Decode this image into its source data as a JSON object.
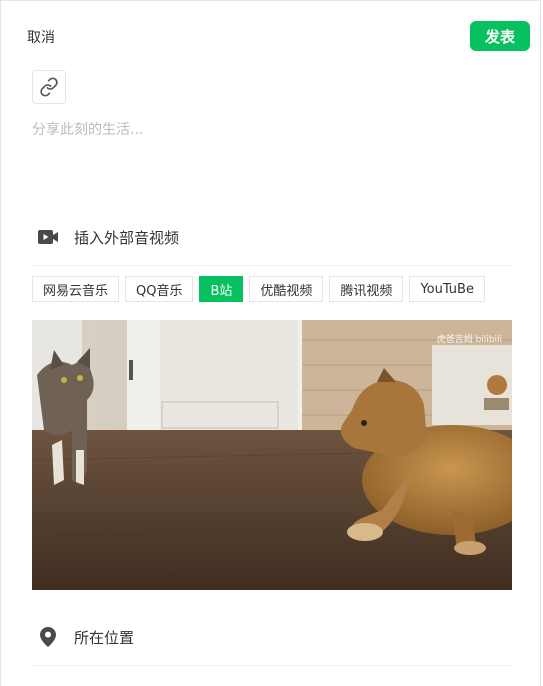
{
  "header": {
    "cancel_label": "取消",
    "publish_label": "发表",
    "accent_color": "#07c160"
  },
  "link_button": {
    "icon": "link-icon"
  },
  "compose": {
    "placeholder": "分享此刻的生活...",
    "value": ""
  },
  "media_row": {
    "icon": "video-icon",
    "label": "插入外部音视频"
  },
  "sources": {
    "tabs": [
      {
        "label": "网易云音乐",
        "active": false
      },
      {
        "label": "QQ音乐",
        "active": false
      },
      {
        "label": "B站",
        "active": true
      },
      {
        "label": "优酷视频",
        "active": false
      },
      {
        "label": "腾讯视频",
        "active": false
      },
      {
        "label": "YouTuBe",
        "active": false
      }
    ]
  },
  "video": {
    "watermark": "虎爸吉姆 bilibili"
  },
  "location_row": {
    "icon": "location-pin-icon",
    "label": "所在位置"
  }
}
